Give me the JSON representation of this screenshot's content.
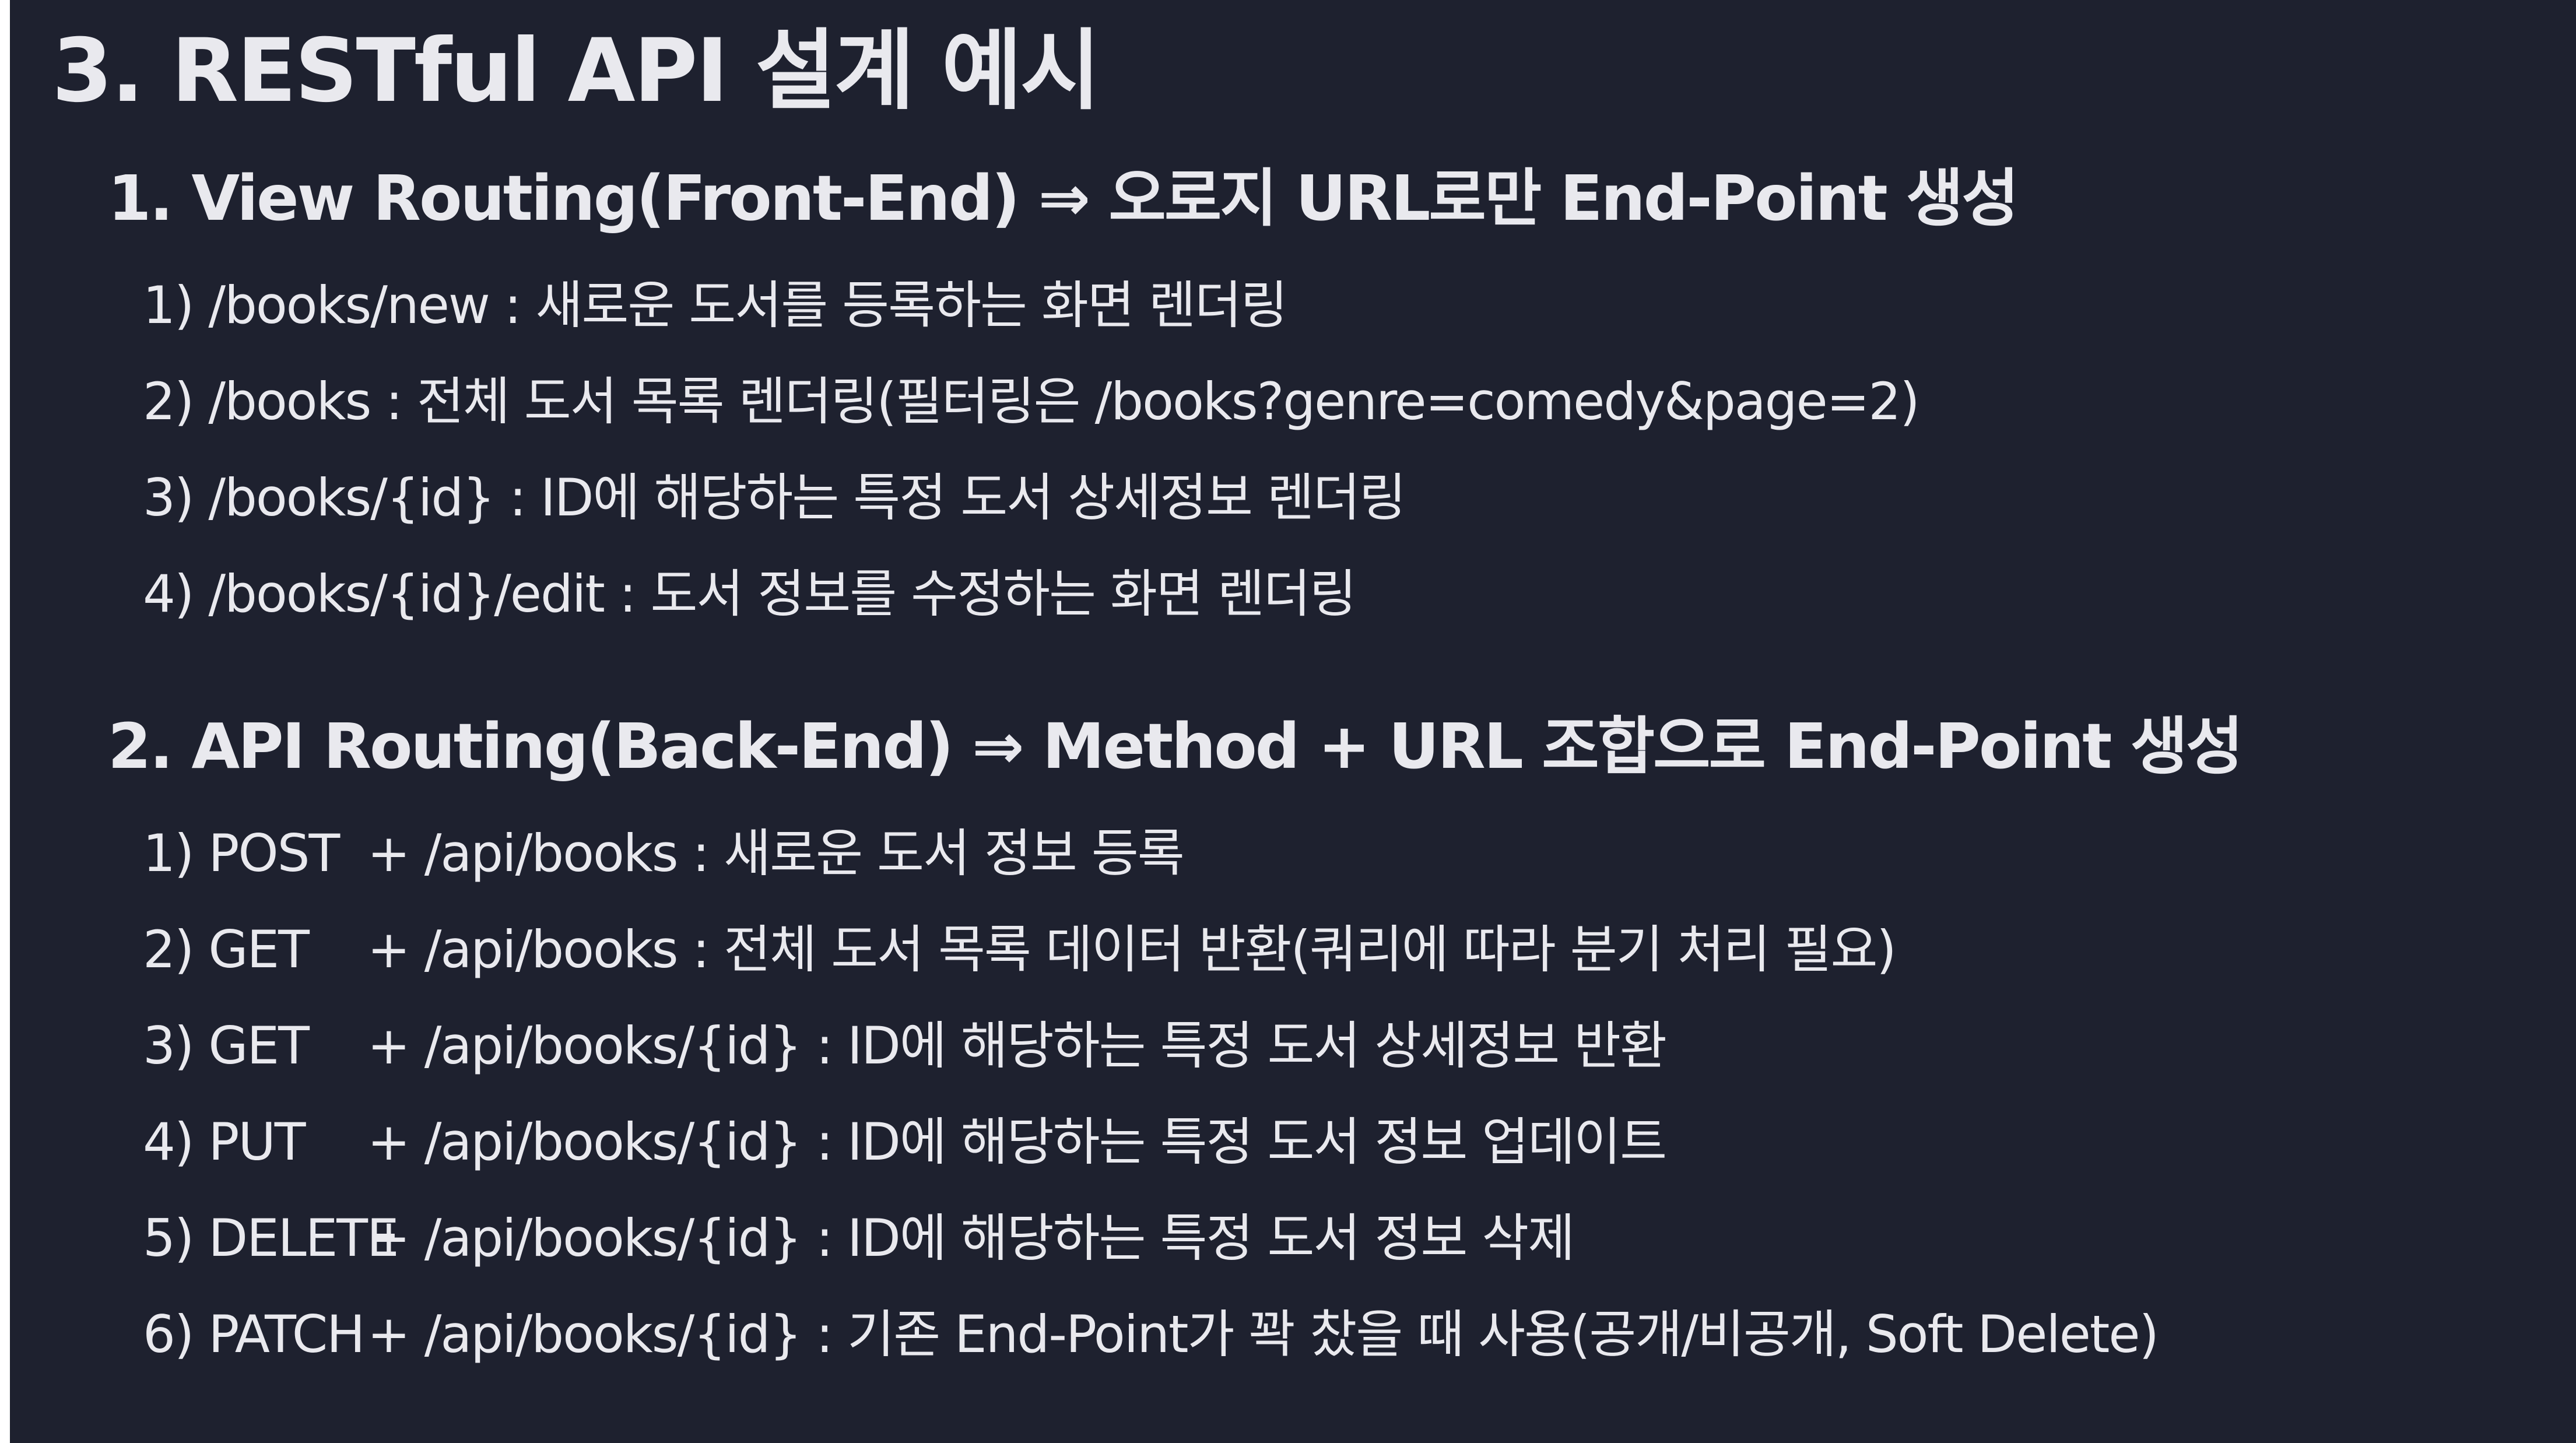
{
  "title": "3. RESTful API 설계 예시",
  "view_routing": {
    "heading": "1. View Routing(Front-End) ⇒ 오로지 URL로만 End-Point 생성",
    "items": [
      {
        "num": "1)",
        "text": "/books/new : 새로운 도서를 등록하는 화면 렌더링"
      },
      {
        "num": "2)",
        "text": "/books : 전체 도서 목록 렌더링(필터링은 /books?genre=comedy&page=2)"
      },
      {
        "num": "3)",
        "text": "/books/{id} : ID에 해당하는 특정 도서 상세정보 렌더링"
      },
      {
        "num": "4)",
        "text": "/books/{id}/edit : 도서 정보를 수정하는 화면 렌더링"
      }
    ]
  },
  "api_routing": {
    "heading": "2. API Routing(Back-End) ⇒ Method + URL 조합으로 End-Point 생성",
    "items": [
      {
        "num": "1)",
        "method": "POST",
        "text": "+ /api/books : 새로운 도서 정보 등록"
      },
      {
        "num": "2)",
        "method": "GET",
        "text": "+ /api/books : 전체 도서 목록 데이터 반환(쿼리에 따라 분기 처리 필요)"
      },
      {
        "num": "3)",
        "method": "GET",
        "text": "+ /api/books/{id} : ID에 해당하는 특정 도서 상세정보 반환"
      },
      {
        "num": "4)",
        "method": "PUT",
        "text": "+ /api/books/{id} : ID에 해당하는 특정 도서 정보 업데이트"
      },
      {
        "num": "5)",
        "method": "DELETE",
        "text": "+ /api/books/{id} : ID에 해당하는 특정 도서 정보 삭제"
      },
      {
        "num": "6)",
        "method": "PATCH",
        "text": "+ /api/books/{id} : 기존 End-Point가 꽉 찼을 때 사용(공개/비공개, Soft Delete)"
      }
    ]
  },
  "colors": {
    "background": "#1e212f",
    "text": "#e9e9ee",
    "left_border": "#ffffff"
  }
}
